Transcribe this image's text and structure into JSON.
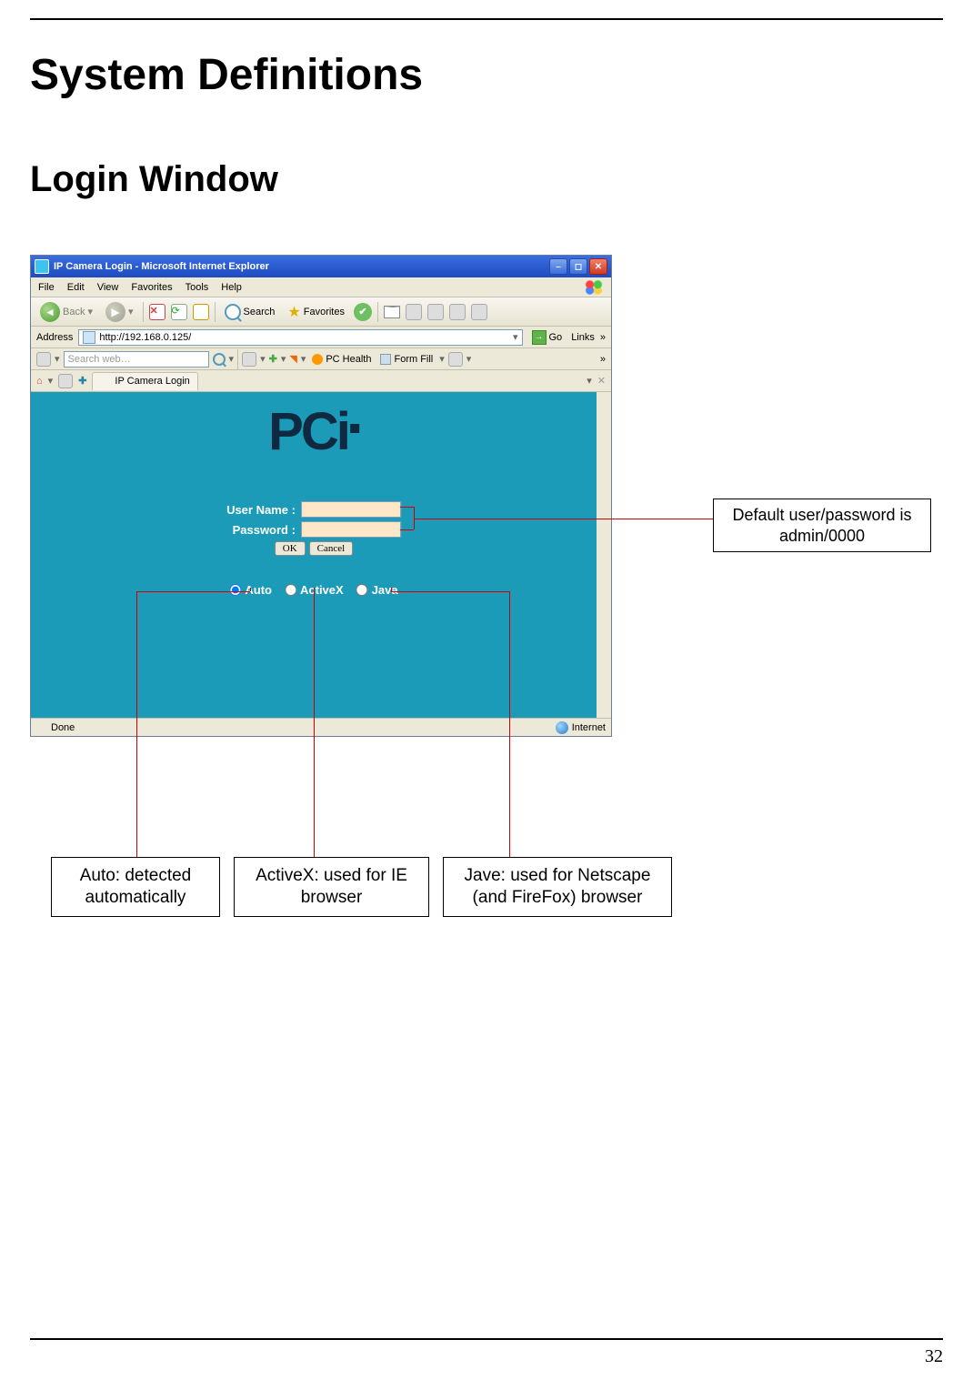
{
  "page": {
    "title": "System Definitions",
    "subtitle": "Login Window",
    "page_number": "32"
  },
  "browser": {
    "window_title": "IP Camera Login - Microsoft Internet Explorer",
    "menus": [
      "File",
      "Edit",
      "View",
      "Favorites",
      "Tools",
      "Help"
    ],
    "toolbar": {
      "back": "Back",
      "search": "Search",
      "favorites": "Favorites"
    },
    "address_label": "Address",
    "address_value": "http://192.168.0.125/",
    "go": "Go",
    "links": "Links",
    "chevron": "»",
    "searchbar": {
      "placeholder": "Search web…",
      "pc_health": "PC Health",
      "form_fill": "Form Fill"
    },
    "tab_label": "IP Camera Login",
    "status_left": "Done",
    "status_right": "Internet"
  },
  "login": {
    "logo_text": "PCi",
    "username_label": "User Name :",
    "password_label": "Password :",
    "ok": "OK",
    "cancel": "Cancel",
    "radio": {
      "auto": "Auto",
      "activex": "ActiveX",
      "java": "Java"
    }
  },
  "annotations": {
    "default_creds": "Default user/password is admin/0000",
    "auto": "Auto: detected automatically",
    "activex": "ActiveX: used for IE browser",
    "java": "Jave: used for Netscape (and FireFox) browser"
  }
}
